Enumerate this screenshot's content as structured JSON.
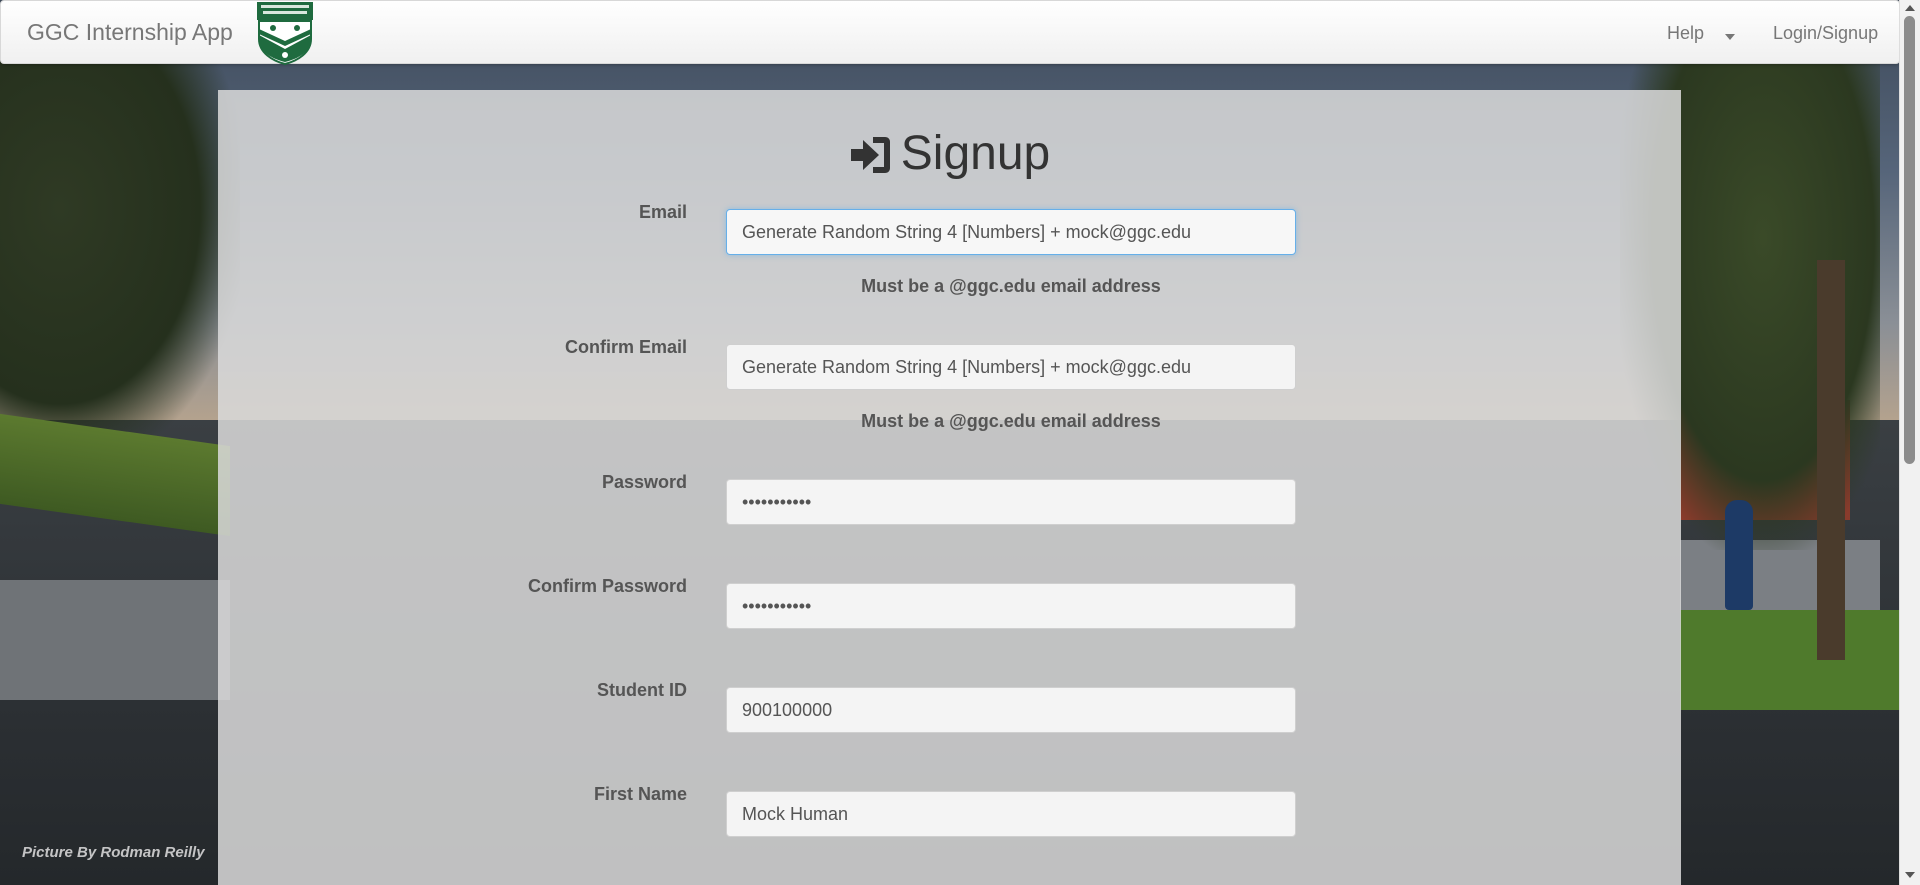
{
  "navbar": {
    "brand": "GGC Internship App",
    "help_label": "Help",
    "login_label": "Login/Signup"
  },
  "page": {
    "title": "Signup",
    "photo_credit": "Picture By Rodman Reilly"
  },
  "form": {
    "email": {
      "label": "Email",
      "value": "Generate Random String 4 [Numbers] + mock@ggc.edu",
      "help": "Must be a @ggc.edu email address"
    },
    "confirm_email": {
      "label": "Confirm Email",
      "value": "Generate Random String 4 [Numbers] + mock@ggc.edu",
      "help": "Must be a @ggc.edu email address"
    },
    "password": {
      "label": "Password",
      "value": "•••••••••••"
    },
    "confirm_password": {
      "label": "Confirm Password",
      "value": "•••••••••••"
    },
    "student_id": {
      "label": "Student ID",
      "value": "900100000"
    },
    "first_name": {
      "label": "First Name",
      "value": "Mock Human"
    }
  },
  "colors": {
    "focus_border": "#66afe9",
    "label_text": "#555555",
    "title_text": "#333333"
  }
}
